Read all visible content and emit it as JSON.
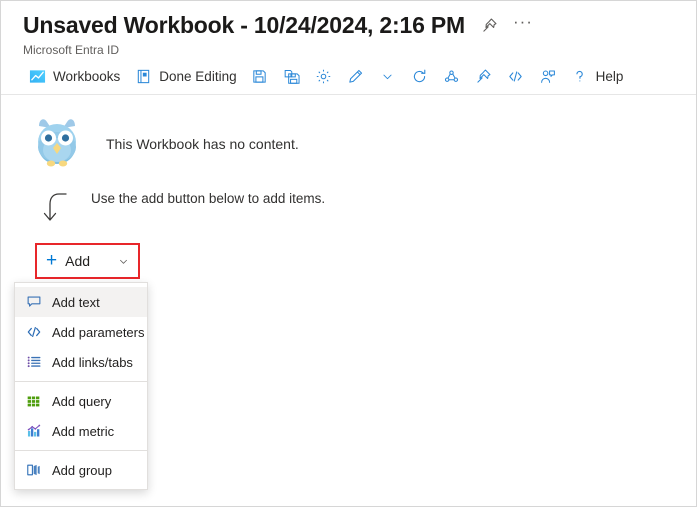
{
  "header": {
    "title": "Unsaved Workbook - 10/24/2024, 2:16 PM",
    "subtitle": "Microsoft Entra ID",
    "pin_icon": "pin-icon",
    "more_label": "···"
  },
  "toolbar": {
    "items": [
      {
        "label": "Workbooks",
        "icon": "workbooks-chart-icon",
        "name": "workbooks"
      },
      {
        "label": "Done Editing",
        "icon": "done-editing-icon",
        "name": "done-editing"
      },
      {
        "label": "",
        "icon": "save-icon",
        "name": "save"
      },
      {
        "label": "",
        "icon": "save-as-icon",
        "name": "save-as"
      },
      {
        "label": "",
        "icon": "gear-icon",
        "name": "settings"
      },
      {
        "label": "",
        "icon": "pencil-icon",
        "name": "edit"
      },
      {
        "label": "",
        "icon": "chevron-down-icon",
        "name": "edit-menu"
      },
      {
        "label": "",
        "icon": "refresh-icon",
        "name": "refresh"
      },
      {
        "label": "",
        "icon": "share-icon",
        "name": "share"
      },
      {
        "label": "",
        "icon": "pin-icon",
        "name": "pin"
      },
      {
        "label": "",
        "icon": "code-icon",
        "name": "code"
      },
      {
        "label": "",
        "icon": "add-user-icon",
        "name": "assign"
      },
      {
        "label": "Help",
        "icon": "question-icon",
        "name": "help"
      }
    ]
  },
  "content": {
    "empty_icon": "owl-icon",
    "empty_message": "This Workbook has no content.",
    "hint_icon": "curved-arrow-down-icon",
    "hint_message": "Use the add button below to add items.",
    "add_button": {
      "label": "Add",
      "plus_icon": "plus-icon",
      "chevron_icon": "chevron-down-icon",
      "highlight_color": "#e8262a"
    }
  },
  "menu": {
    "items": [
      {
        "label": "Add text",
        "icon": "text-comment-icon",
        "name": "add-text",
        "selected": true
      },
      {
        "label": "Add parameters",
        "icon": "code-brackets-icon",
        "name": "add-parameters",
        "selected": false
      },
      {
        "label": "Add links/tabs",
        "icon": "list-links-icon",
        "name": "add-links-tabs",
        "selected": false
      },
      {
        "label": "Add query",
        "icon": "grid-query-icon",
        "name": "add-query",
        "selected": false
      },
      {
        "label": "Add metric",
        "icon": "bar-chart-metric-icon",
        "name": "add-metric",
        "selected": false
      },
      {
        "label": "Add group",
        "icon": "group-panels-icon",
        "name": "add-group",
        "selected": false
      }
    ],
    "dividers_after": [
      2,
      4
    ]
  },
  "colors": {
    "accent": "#0078d4",
    "icon_blue": "#2b88d8",
    "highlight_red": "#e8262a",
    "query_green": "#51a300",
    "text": "#201f1e",
    "subtext": "#605e5c"
  }
}
